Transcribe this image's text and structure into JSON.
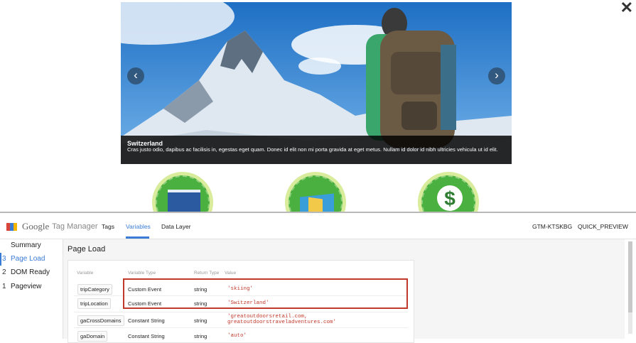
{
  "site": {
    "close_icon": "close-icon",
    "carousel": {
      "title": "Switzerland",
      "text": "Cras justo odio, dapibus ac facilisis in, egestas eget quam. Donec id elit non mi porta gravida at eget metus. Nullam id dolor id nibh ultricies vehicula ut id elit.",
      "prev_label": "‹",
      "next_label": "›"
    },
    "badges": [
      "bed-icon",
      "map-icon",
      "dollar-icon"
    ],
    "dollar_glyph": "$"
  },
  "gtm": {
    "logo": {
      "google": "Google",
      "product": "Tag Manager"
    },
    "tabs": [
      {
        "label": "Tags"
      },
      {
        "label": "Variables",
        "active": true
      },
      {
        "label": "Data Layer"
      }
    ],
    "container_id": "GTM-KTSKBG",
    "mode": "QUICK_PREVIEW",
    "sidebar": [
      {
        "num": "",
        "label": "Summary"
      },
      {
        "num": "3",
        "label": "Page Load",
        "active": true
      },
      {
        "num": "2",
        "label": "DOM Ready"
      },
      {
        "num": "1",
        "label": "Pageview"
      }
    ],
    "page_title": "Page Load",
    "table": {
      "headers": [
        "Variable",
        "Variable Type",
        "Return Type",
        "Value"
      ],
      "rows": [
        {
          "variable": "tripCategory",
          "type": "Custom Event",
          "return": "string",
          "value": "'skiing'"
        },
        {
          "variable": "tripLocation",
          "type": "Custom Event",
          "return": "string",
          "value": "'Switzerland'"
        },
        {
          "variable": "gaCrossDomains",
          "type": "Constant String",
          "return": "string",
          "value": "'greatoutdoorsretail.com,",
          "value2": "greatoutdoorstraveladventures.com'"
        },
        {
          "variable": "gaDomain",
          "type": "Constant String",
          "return": "string",
          "value": "'auto'"
        }
      ]
    },
    "colors": {
      "accent": "#3a7bd5",
      "highlight": "#c0392b"
    }
  }
}
